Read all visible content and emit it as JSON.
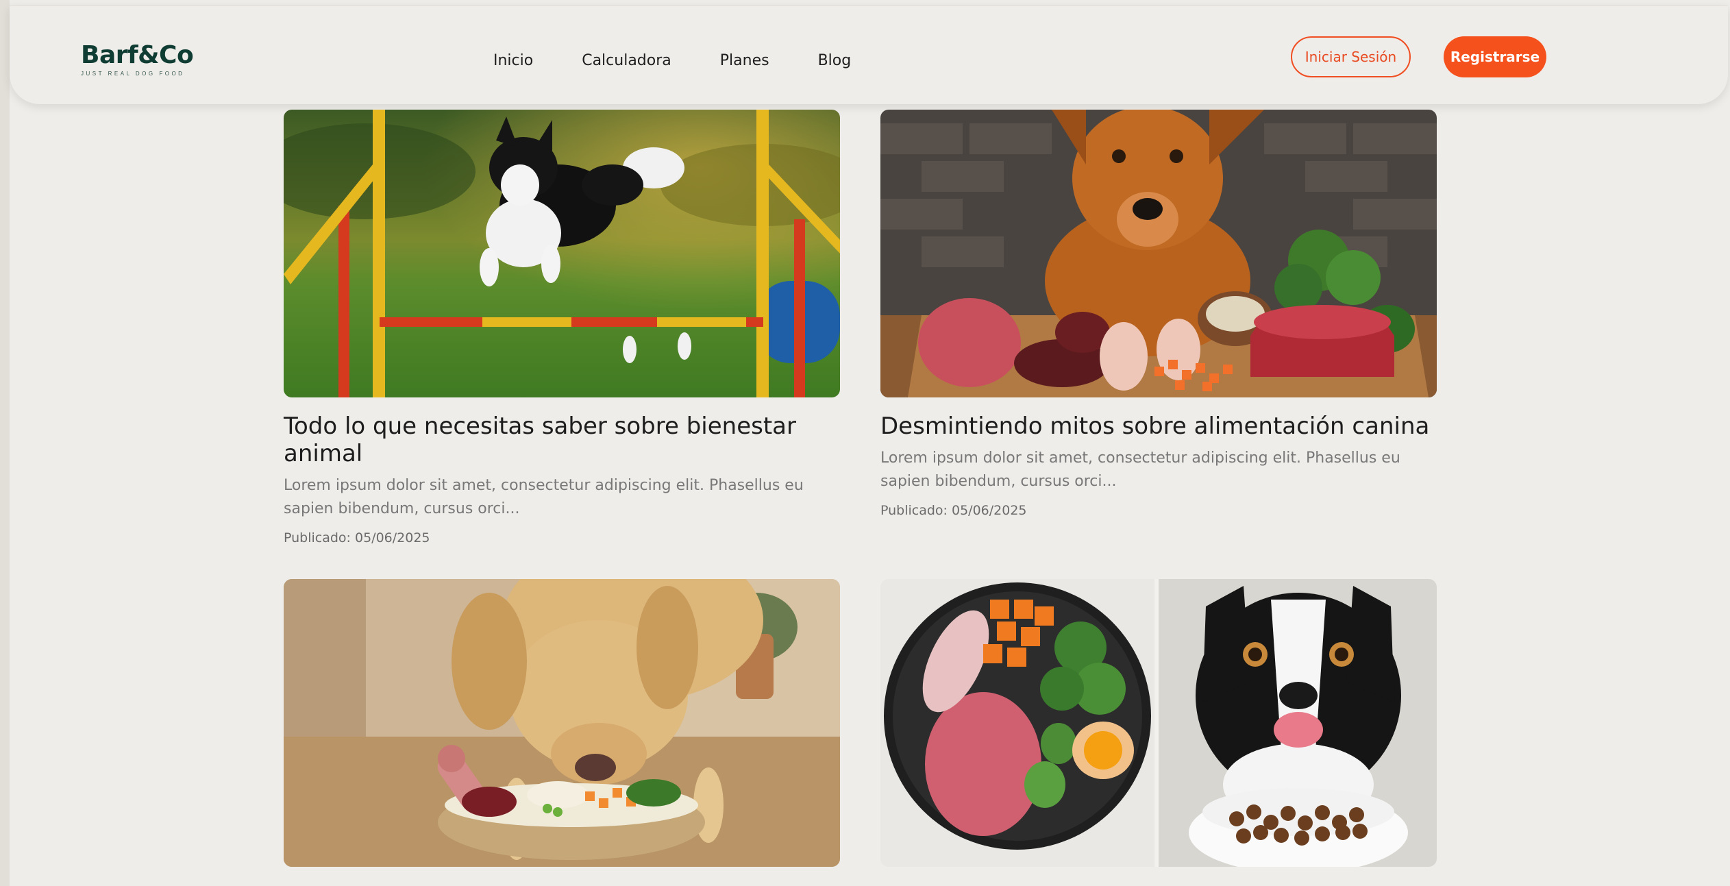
{
  "brand": {
    "name": "Barf&Co",
    "tagline": "JUST REAL DOG FOOD"
  },
  "nav": {
    "items": [
      "Inicio",
      "Calculadora",
      "Planes",
      "Blog"
    ]
  },
  "auth": {
    "login_label": "Iniciar Sesión",
    "register_label": "Registrarse"
  },
  "colors": {
    "accent": "#f5511d",
    "brand": "#103d33",
    "background": "#efede9"
  },
  "posts": [
    {
      "title": "Todo lo que necesitas saber sobre bienestar animal",
      "excerpt": "Lorem ipsum dolor sit amet, consectetur adipiscing elit. Phasellus eu sapien bibendum, cursus orci...",
      "date": "Publicado: 05/06/2025"
    },
    {
      "title": "Desmintiendo mitos sobre alimentación canina",
      "excerpt": "Lorem ipsum dolor sit amet, consectetur adipiscing elit. Phasellus eu sapien bibendum, cursus orci...",
      "date": "Publicado: 05/06/2025"
    },
    {
      "title": "",
      "excerpt": "",
      "date": ""
    },
    {
      "title": "",
      "excerpt": "",
      "date": ""
    }
  ]
}
